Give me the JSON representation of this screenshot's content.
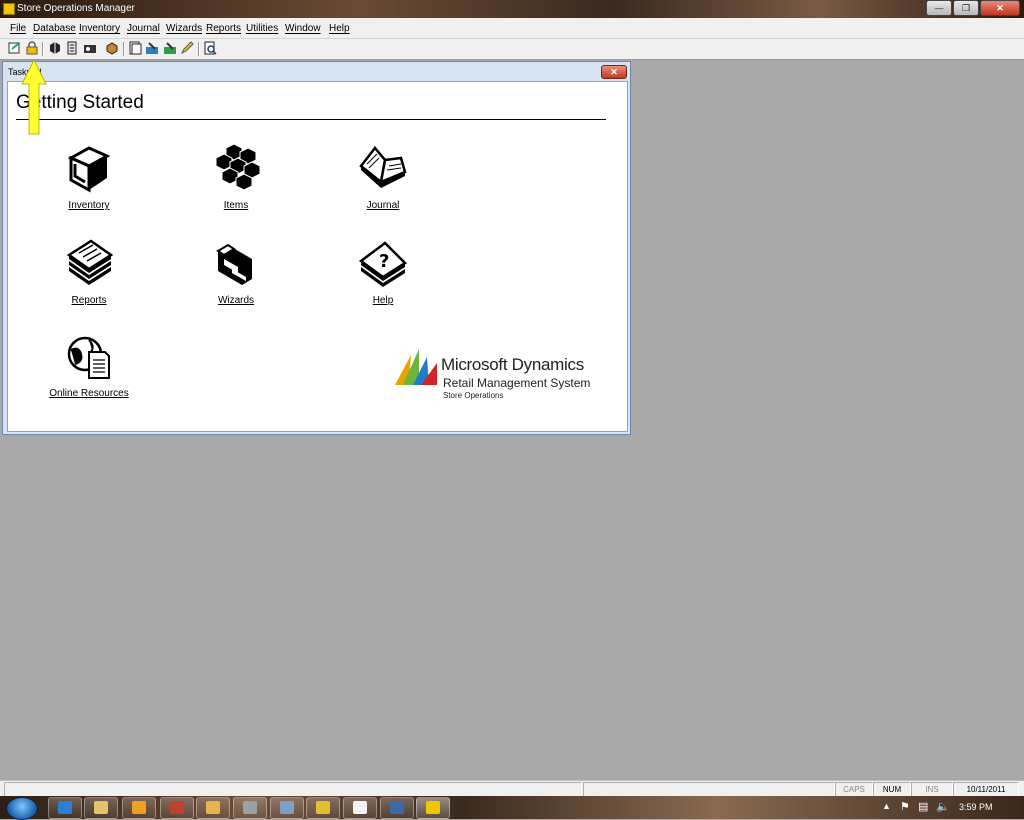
{
  "window": {
    "title": "Store Operations Manager"
  },
  "menu": [
    "File",
    "Database",
    "Inventory",
    "Journal",
    "Wizards",
    "Reports",
    "Utilities",
    "Window",
    "Help"
  ],
  "toolbar_icons": [
    "open-icon",
    "lock-icon",
    "items-icon",
    "list-icon",
    "customers-icon",
    "reports-icon",
    "journal-icon",
    "wizard-icon",
    "export-icon",
    "pencil-icon",
    "help-icon"
  ],
  "taskpad": {
    "title": "Taskpad",
    "heading": "Getting Started",
    "tiles": [
      {
        "label": "Inventory",
        "icon": "inventory-box-icon"
      },
      {
        "label": "Items",
        "icon": "items-cubes-icon"
      },
      {
        "label": "Journal",
        "icon": "journal-book-icon"
      },
      {
        "label": "Reports",
        "icon": "reports-stack-icon"
      },
      {
        "label": "Wizards",
        "icon": "wizards-icon"
      },
      {
        "label": "Help",
        "icon": "help-question-icon"
      },
      {
        "label": "Online Resources",
        "icon": "globe-document-icon"
      }
    ],
    "brand": {
      "line1": "Microsoft Dynamics",
      "line2": "Retail Management System",
      "line3": "Store Operations"
    }
  },
  "statusbar": {
    "caps": "CAPS",
    "num": "NUM",
    "ins": "INS",
    "date": "10/11/2011"
  },
  "taskbar": {
    "time": "3:59 PM"
  },
  "colors": {
    "desktop": "#a9a9a9",
    "arrow": "#ffff33",
    "taskpad_border": "#6d88ad"
  }
}
